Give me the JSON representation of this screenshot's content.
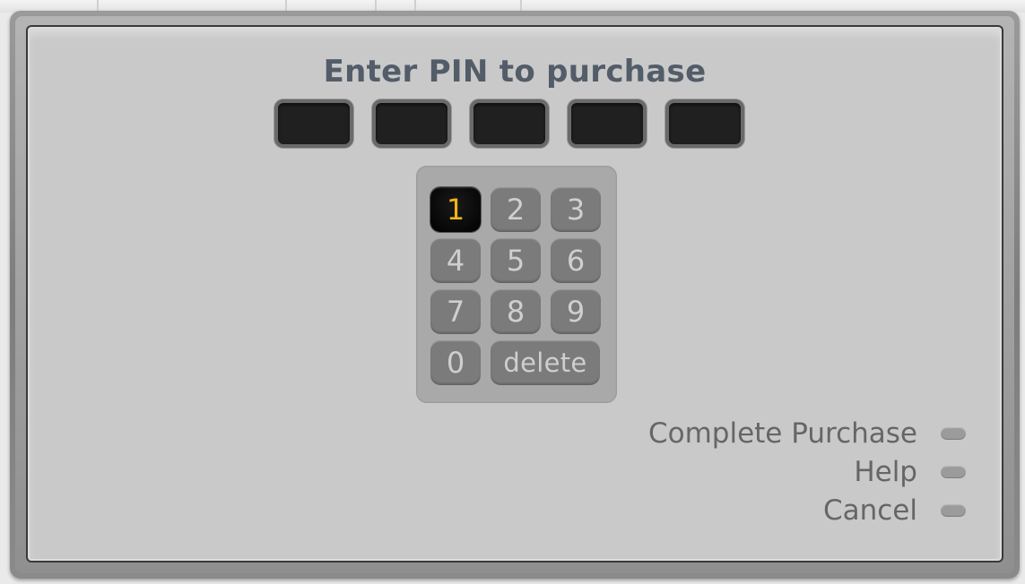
{
  "dialog": {
    "title": "Enter PIN to purchase"
  },
  "pin": {
    "digits": [
      "",
      "",
      "",
      "",
      ""
    ]
  },
  "keypad": {
    "selected": "1",
    "keys": [
      {
        "label": "1"
      },
      {
        "label": "2"
      },
      {
        "label": "3"
      },
      {
        "label": "4"
      },
      {
        "label": "5"
      },
      {
        "label": "6"
      },
      {
        "label": "7"
      },
      {
        "label": "8"
      },
      {
        "label": "9"
      },
      {
        "label": "0"
      },
      {
        "label": "delete"
      }
    ]
  },
  "menu": {
    "items": [
      {
        "label": "Complete Purchase"
      },
      {
        "label": "Help"
      },
      {
        "label": "Cancel"
      }
    ]
  },
  "colors": {
    "title": "#535d69",
    "selected_key_text": "#f1b21c",
    "panel_background": "#c9c9c9"
  }
}
